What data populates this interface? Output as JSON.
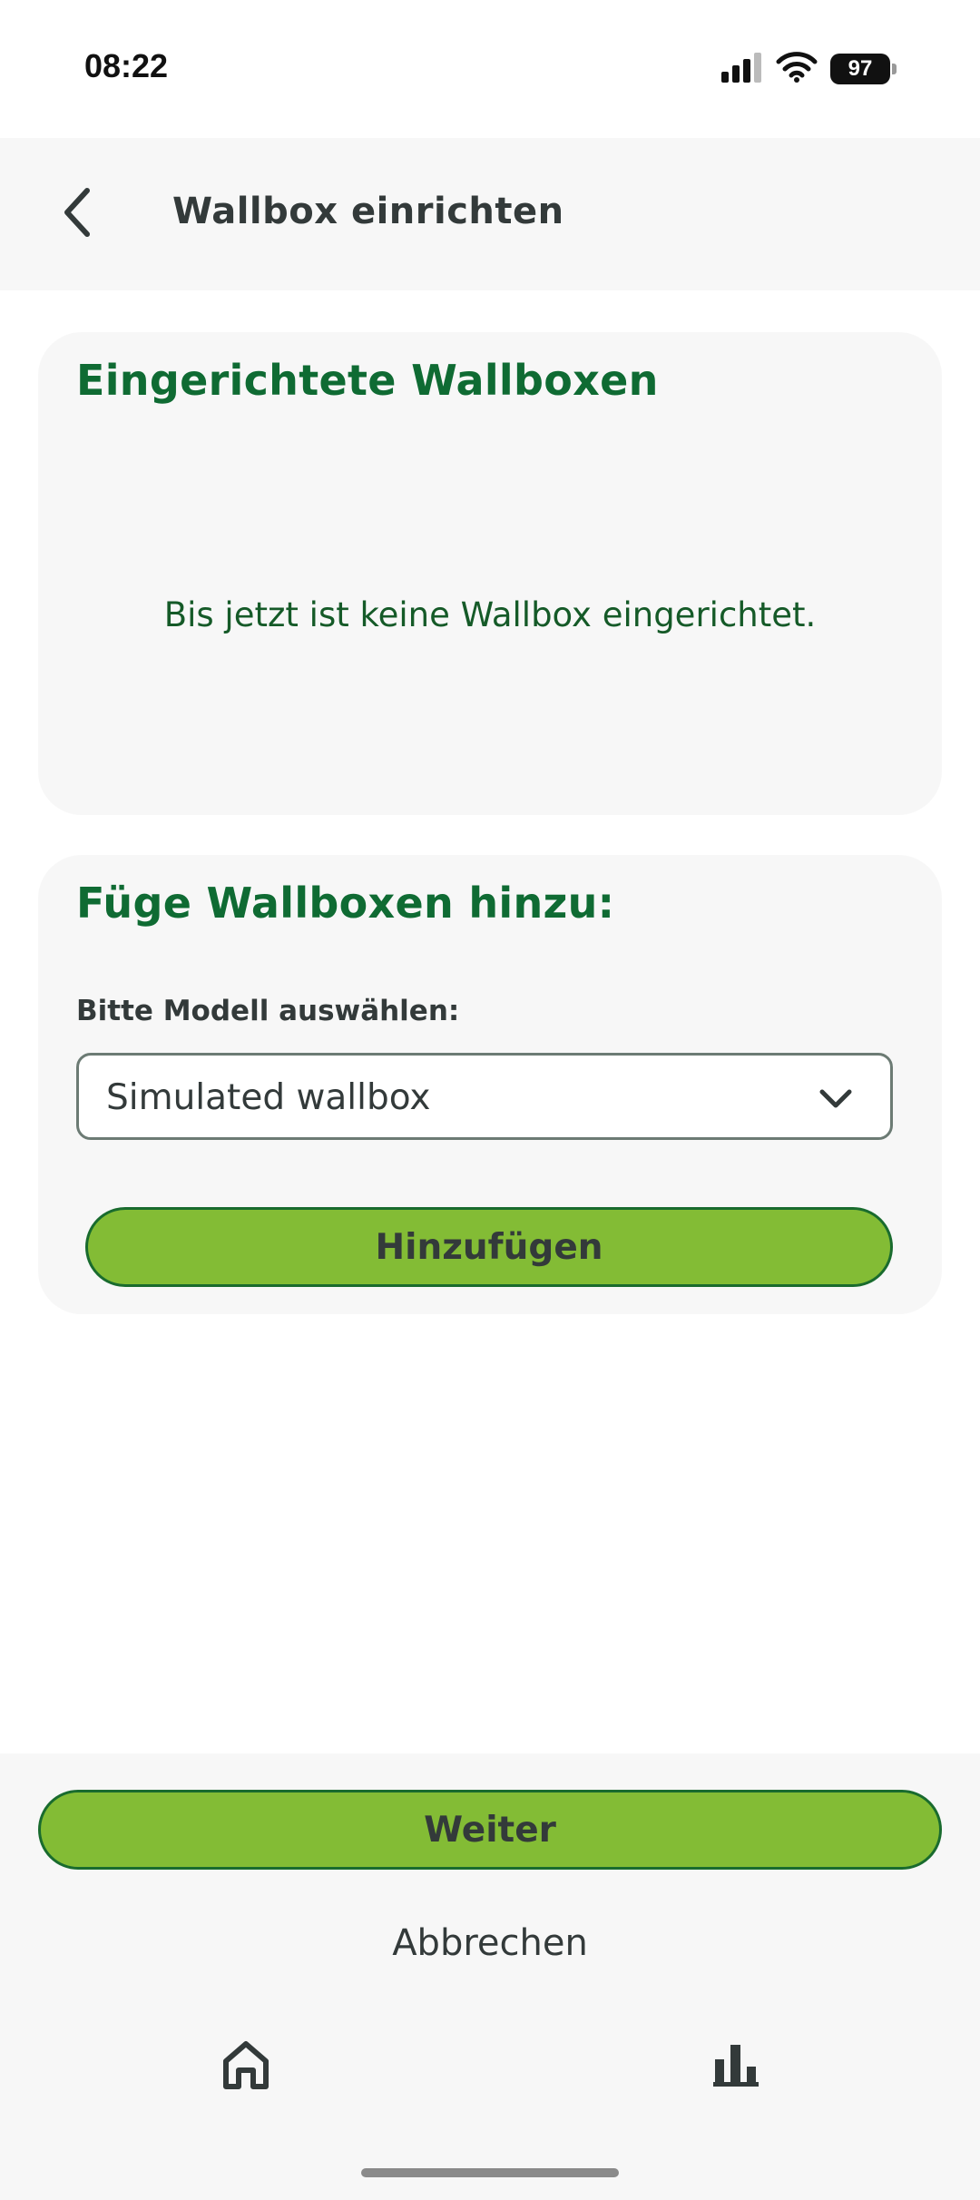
{
  "status_bar": {
    "time": "08:22",
    "battery": "97",
    "icons": [
      "signal-icon",
      "wifi-icon",
      "battery-icon"
    ]
  },
  "header": {
    "title": "Wallbox einrichten",
    "back_icon": "chevron-left-icon"
  },
  "installed_card": {
    "title": "Eingerichtete Wallboxen",
    "empty_message": "Bis jetzt ist keine Wallbox eingerichtet."
  },
  "add_card": {
    "title": "Füge Wallboxen hinzu:",
    "model_label": "Bitte Modell auswählen:",
    "model_selected": "Simulated wallbox",
    "add_button": "Hinzufügen"
  },
  "footer": {
    "continue_button": "Weiter",
    "cancel_button": "Abbrechen"
  },
  "tab_bar": {
    "tabs": [
      {
        "icon": "home-icon"
      },
      {
        "icon": "bar-chart-icon"
      }
    ]
  },
  "colors": {
    "accent_green": "#83bc35",
    "title_green": "#0f6b33",
    "panel_gray": "#f7f7f7"
  }
}
